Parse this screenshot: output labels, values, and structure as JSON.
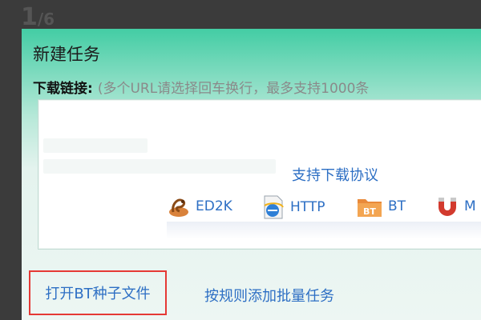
{
  "page_counter": {
    "current": "1",
    "total": "/6"
  },
  "dialog": {
    "title": "新建任务",
    "link_label": "下载链接:",
    "link_hint": "(多个URL请选择回车换行，最多支持1000条",
    "url_value": "",
    "protocols_title": "支持下载协议",
    "protocols": [
      {
        "label": "ED2K",
        "icon": "ed2k-icon"
      },
      {
        "label": "HTTP",
        "icon": "http-ie-icon"
      },
      {
        "label": "BT",
        "icon": "bt-folder-icon"
      },
      {
        "label": "M",
        "icon": "magnet-icon"
      }
    ],
    "open_bt_label": "打开BT种子文件",
    "batch_label": "按规则添加批量任务"
  },
  "colors": {
    "link_blue": "#2d6fc4",
    "highlight_red": "#e53935",
    "header_green": "#43cda4"
  }
}
